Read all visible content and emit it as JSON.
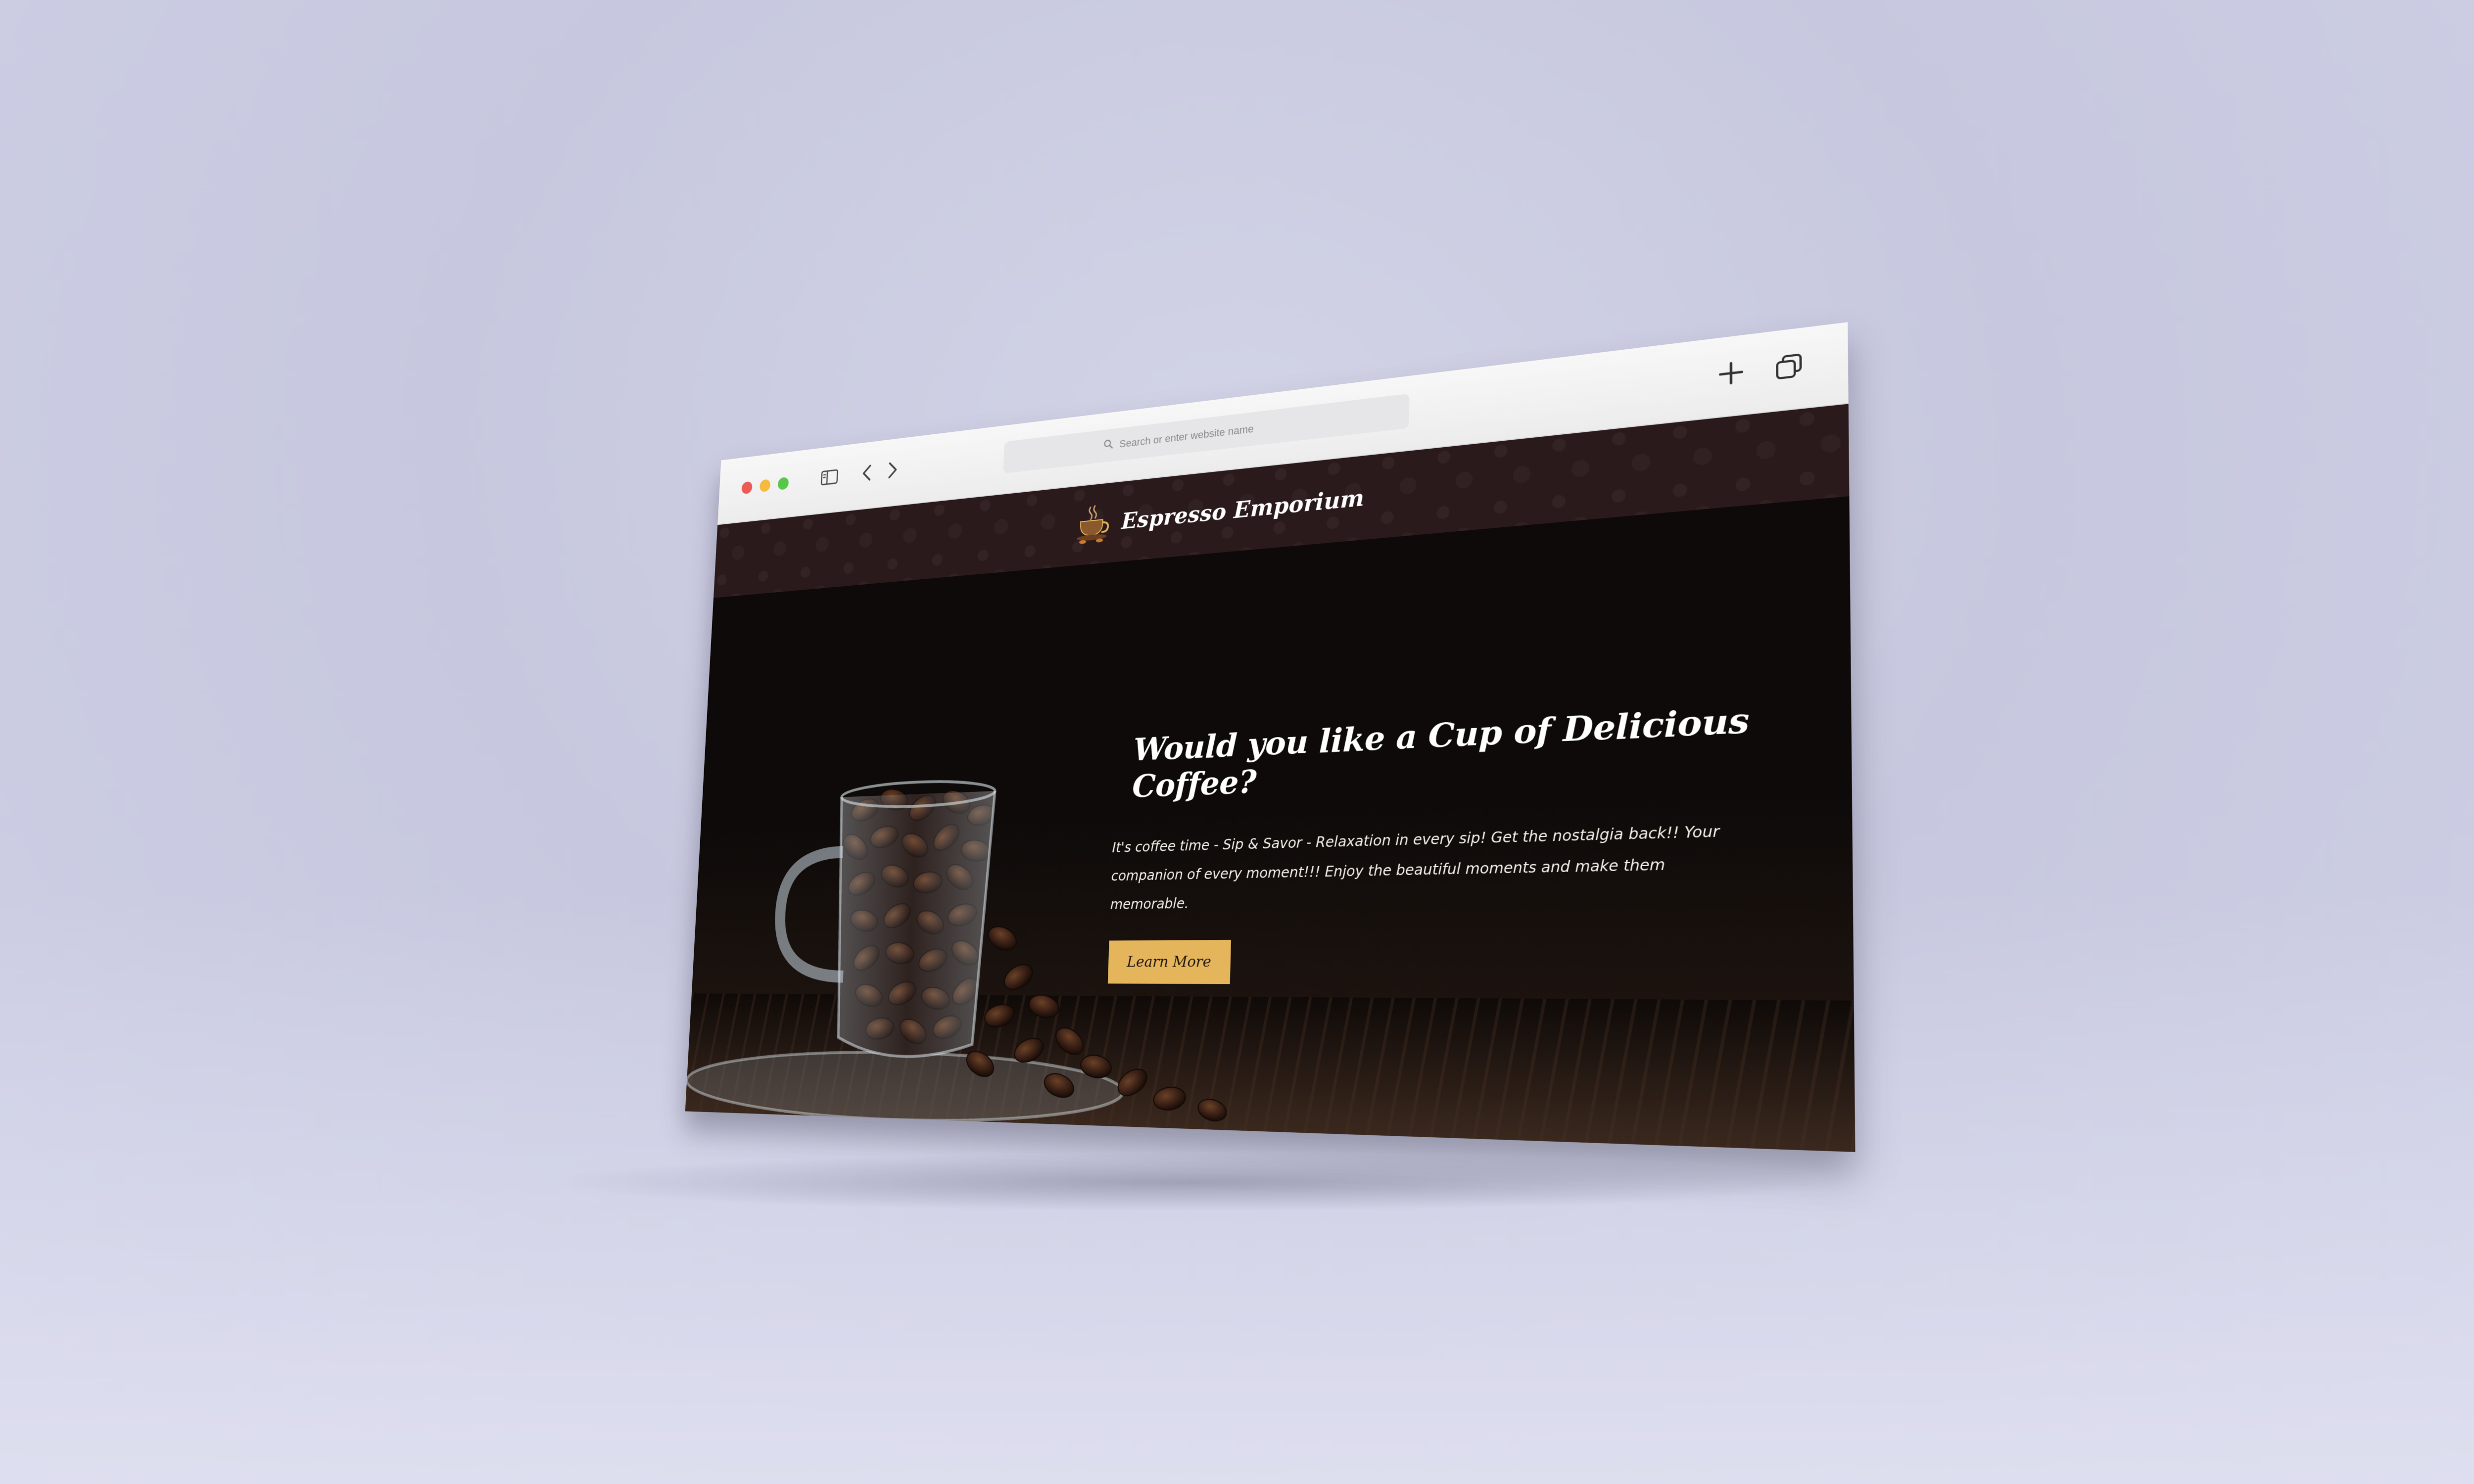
{
  "browser": {
    "address_placeholder": "Search or enter website name",
    "icons": [
      "sidebar-icon",
      "back-icon",
      "forward-icon",
      "search-icon",
      "new-tab-icon",
      "tabs-overview-icon"
    ]
  },
  "site": {
    "brand": "Espresso Emporium",
    "hero": {
      "title": "Would you like a Cup of Delicious Coffee?",
      "description": "It's coffee time - Sip & Savor - Relaxation in every sip! Get the nostalgia back!! Your companion of every moment!!! Enjoy the beautiful moments and make them memorable.",
      "cta_label": "Learn More"
    }
  },
  "colors": {
    "header_bg": "#2b1a1c",
    "cta_bg": "#e5b55c",
    "hero_bg": "#0b0807"
  }
}
